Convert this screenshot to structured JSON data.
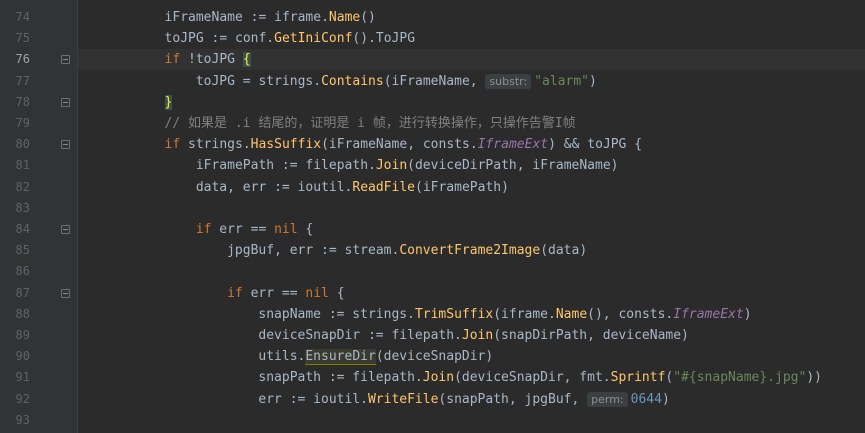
{
  "editor": {
    "lines": [
      {
        "n": "74",
        "tokens": [
          {
            "t": "iFrameName := iframe.",
            "c": "var"
          },
          {
            "t": "Name",
            "c": "mth"
          },
          {
            "t": "()",
            "c": "var"
          }
        ],
        "indent": 12
      },
      {
        "n": "75",
        "tokens": [
          {
            "t": "toJPG := conf.",
            "c": "var"
          },
          {
            "t": "GetIniConf",
            "c": "mth"
          },
          {
            "t": "().ToJPG",
            "c": "var"
          }
        ],
        "indent": 12
      },
      {
        "n": "76",
        "tokens": [
          {
            "t": "if",
            "c": "kw"
          },
          {
            "t": " !toJPG ",
            "c": "var"
          },
          {
            "t": "{",
            "c": "brace-hl"
          }
        ],
        "indent": 12,
        "current": true,
        "fold": "start"
      },
      {
        "n": "77",
        "tokens": [
          {
            "t": "toJPG = strings.",
            "c": "var"
          },
          {
            "t": "Contains",
            "c": "mth"
          },
          {
            "t": "(iFrameName, ",
            "c": "var"
          },
          {
            "t": "substr:",
            "c": "hint"
          },
          {
            "t": "\"alarm\"",
            "c": "str"
          },
          {
            "t": ")",
            "c": "var"
          }
        ],
        "indent": 16
      },
      {
        "n": "78",
        "tokens": [
          {
            "t": "}",
            "c": "brace-hl"
          }
        ],
        "indent": 12,
        "fold": "end"
      },
      {
        "n": "79",
        "tokens": [
          {
            "t": "// 如果是 .i 结尾的，证明是 i 帧，进行转换操作，只操作告警I帧",
            "c": "cmt"
          }
        ],
        "indent": 12
      },
      {
        "n": "80",
        "tokens": [
          {
            "t": "if",
            "c": "kw"
          },
          {
            "t": " strings.",
            "c": "var"
          },
          {
            "t": "HasSuffix",
            "c": "mth"
          },
          {
            "t": "(iFrameName, consts.",
            "c": "var"
          },
          {
            "t": "IframeExt",
            "c": "type"
          },
          {
            "t": ") && toJPG {",
            "c": "var"
          }
        ],
        "indent": 12,
        "fold": "start"
      },
      {
        "n": "81",
        "tokens": [
          {
            "t": "iFramePath := filepath.",
            "c": "var"
          },
          {
            "t": "Join",
            "c": "mth"
          },
          {
            "t": "(deviceDirPath, iFrameName)",
            "c": "var"
          }
        ],
        "indent": 16
      },
      {
        "n": "82",
        "tokens": [
          {
            "t": "data, ",
            "c": "var"
          },
          {
            "t": "err",
            "c": "var"
          },
          {
            "t": " := ioutil.",
            "c": "var"
          },
          {
            "t": "ReadFile",
            "c": "mth"
          },
          {
            "t": "(iFramePath)",
            "c": "var"
          }
        ],
        "indent": 16
      },
      {
        "n": "83",
        "tokens": [],
        "indent": 0
      },
      {
        "n": "84",
        "tokens": [
          {
            "t": "if",
            "c": "kw"
          },
          {
            "t": " err == ",
            "c": "var"
          },
          {
            "t": "nil",
            "c": "kw"
          },
          {
            "t": " {",
            "c": "var"
          }
        ],
        "indent": 16,
        "fold": "start"
      },
      {
        "n": "85",
        "tokens": [
          {
            "t": "jpgBuf, ",
            "c": "var"
          },
          {
            "t": "err",
            "c": "var"
          },
          {
            "t": " := stream.",
            "c": "var"
          },
          {
            "t": "ConvertFrame2Image",
            "c": "mth"
          },
          {
            "t": "(data)",
            "c": "var"
          }
        ],
        "indent": 20
      },
      {
        "n": "86",
        "tokens": [],
        "indent": 0
      },
      {
        "n": "87",
        "tokens": [
          {
            "t": "if",
            "c": "kw"
          },
          {
            "t": " err == ",
            "c": "var"
          },
          {
            "t": "nil",
            "c": "kw"
          },
          {
            "t": " {",
            "c": "var"
          }
        ],
        "indent": 20,
        "fold": "start"
      },
      {
        "n": "88",
        "tokens": [
          {
            "t": "snapName := strings.",
            "c": "var"
          },
          {
            "t": "TrimSuffix",
            "c": "mth"
          },
          {
            "t": "(iframe.",
            "c": "var"
          },
          {
            "t": "Name",
            "c": "mth"
          },
          {
            "t": "(), consts.",
            "c": "var"
          },
          {
            "t": "IframeExt",
            "c": "type"
          },
          {
            "t": ")",
            "c": "var"
          }
        ],
        "indent": 24
      },
      {
        "n": "89",
        "tokens": [
          {
            "t": "deviceSnapDir := filepath.",
            "c": "var"
          },
          {
            "t": "Join",
            "c": "mth"
          },
          {
            "t": "(snapDirPath, deviceName)",
            "c": "var"
          }
        ],
        "indent": 24
      },
      {
        "n": "90",
        "tokens": [
          {
            "t": "utils.",
            "c": "var"
          },
          {
            "t": "EnsureDir",
            "c": "ensure"
          },
          {
            "t": "(deviceSnapDir)",
            "c": "var"
          }
        ],
        "indent": 24
      },
      {
        "n": "91",
        "tokens": [
          {
            "t": "snapPath := filepath.",
            "c": "var"
          },
          {
            "t": "Join",
            "c": "mth"
          },
          {
            "t": "(deviceSnapDir, fmt.",
            "c": "var"
          },
          {
            "t": "Sprintf",
            "c": "mth"
          },
          {
            "t": "(",
            "c": "var"
          },
          {
            "t": "\"#{snapName}.jpg\"",
            "c": "str"
          },
          {
            "t": "))",
            "c": "var"
          }
        ],
        "indent": 24
      },
      {
        "n": "92",
        "tokens": [
          {
            "t": "err := ioutil.",
            "c": "var"
          },
          {
            "t": "WriteFile",
            "c": "mth"
          },
          {
            "t": "(snapPath, jpgBuf, ",
            "c": "var"
          },
          {
            "t": "perm:",
            "c": "hint"
          },
          {
            "t": "0644",
            "c": "num"
          },
          {
            "t": ")",
            "c": "var"
          }
        ],
        "indent": 24
      },
      {
        "n": "93",
        "tokens": [],
        "indent": 0
      }
    ]
  },
  "colors": {
    "background": "#2b2b2b",
    "gutter": "#313335",
    "keyword": "#cc7832",
    "function": "#ffc66d",
    "string": "#6a8759",
    "number": "#6897bb",
    "comment": "#808080",
    "constant": "#9876aa"
  }
}
